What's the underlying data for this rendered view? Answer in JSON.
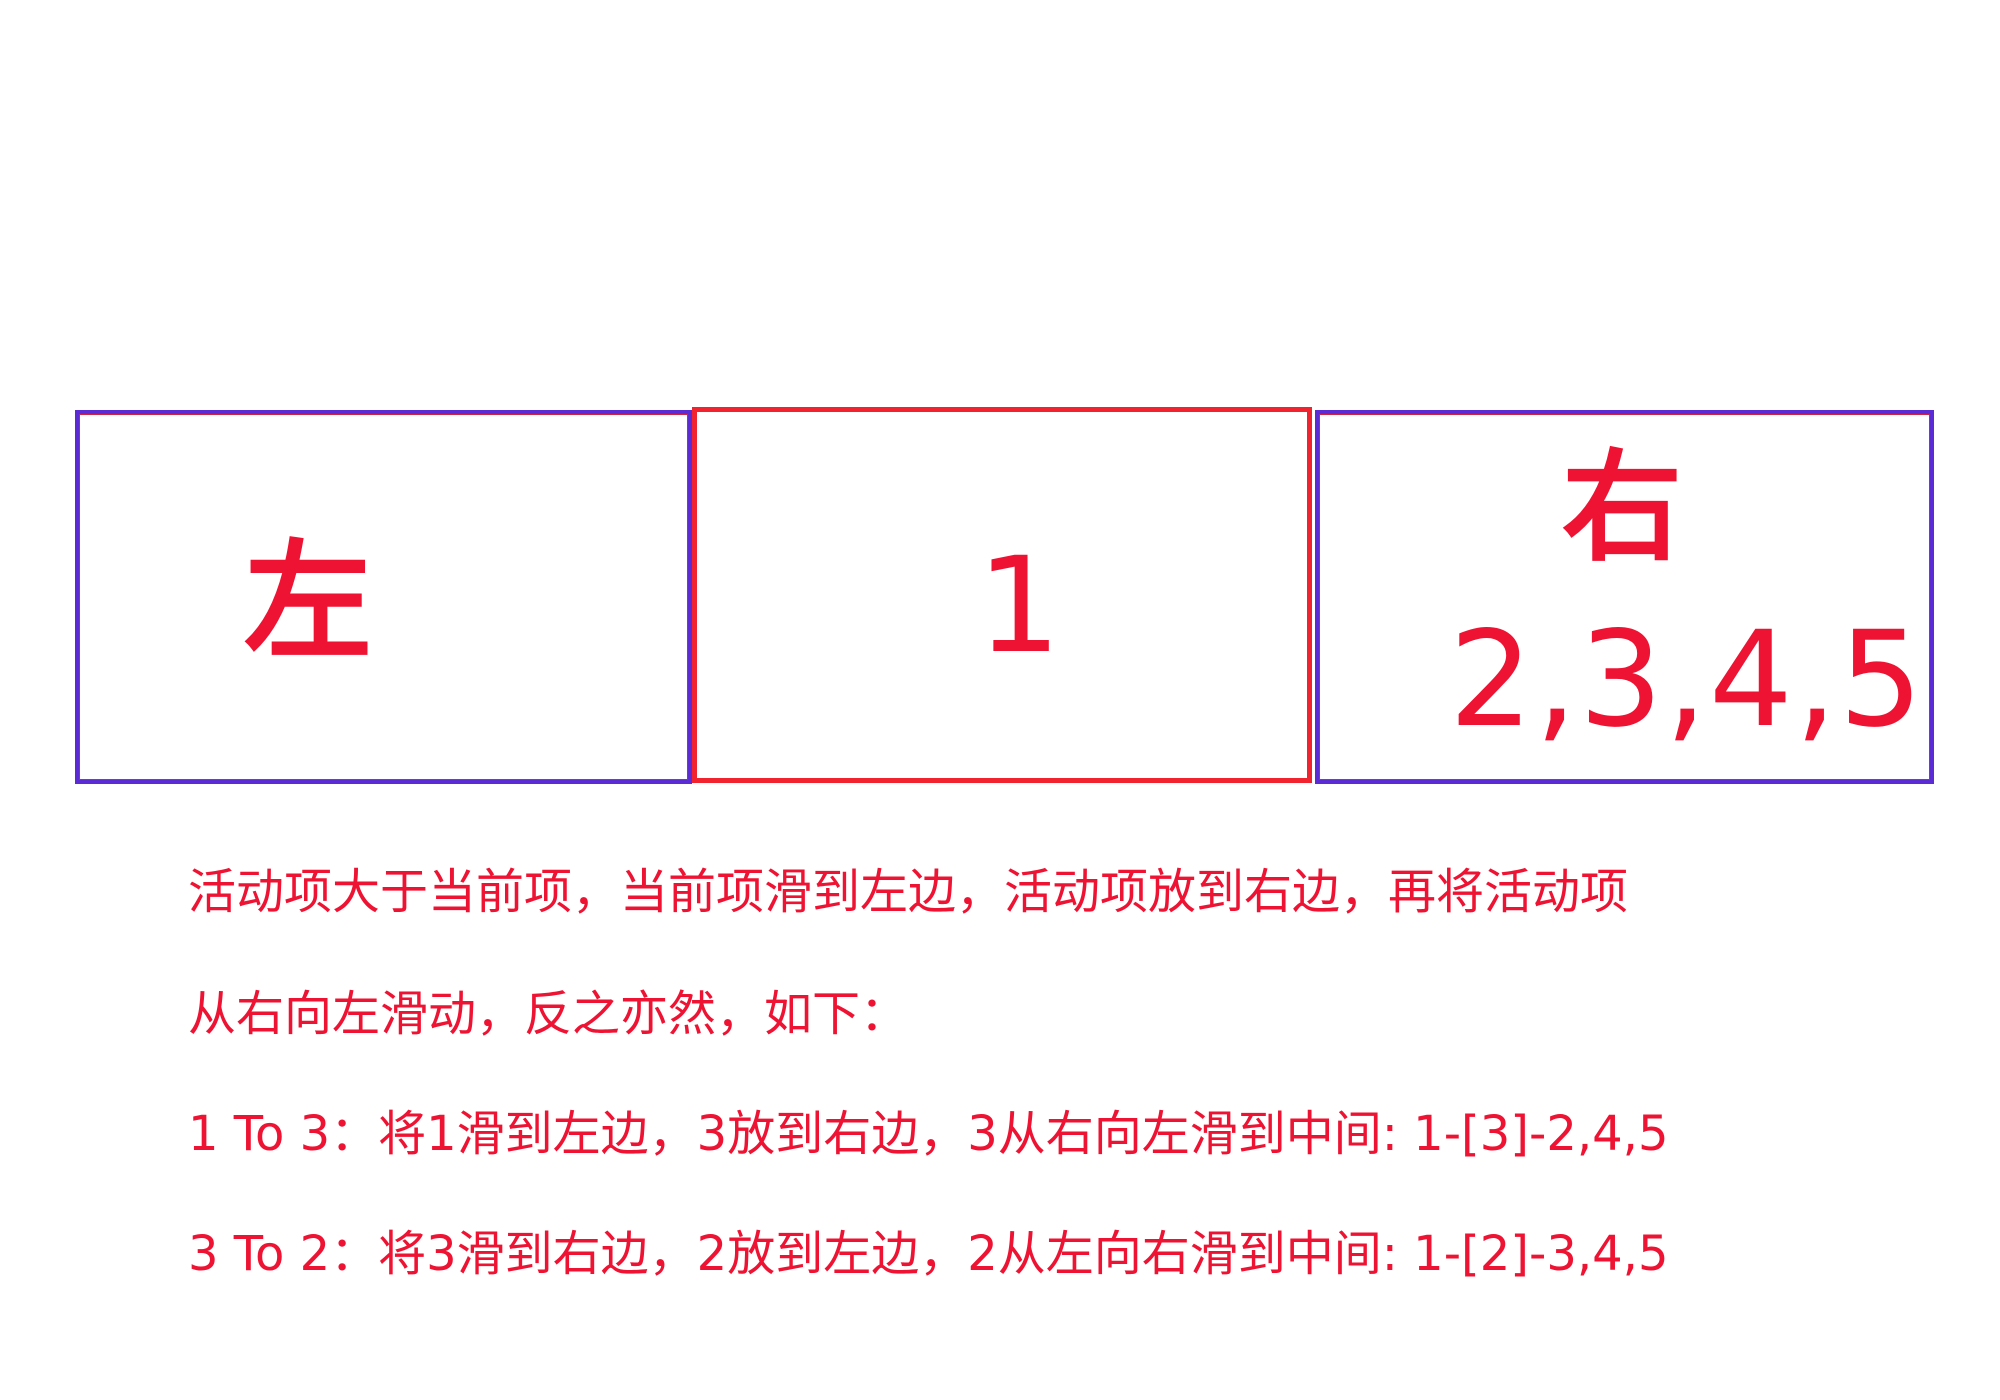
{
  "diagram": {
    "left_label": "左",
    "center_label": "1",
    "right_label": "右",
    "right_items": "2,3,4,5",
    "description": {
      "line1": "活动项大于当前项，当前项滑到左边，活动项放到右边，再将活动项",
      "line2": "从右向左滑动，反之亦然，如下：",
      "line3": "1 To 3：将1滑到左边，3放到右边，3从右向左滑到中间: 1-[3]-2,4,5",
      "line4": "3 To 2：将3滑到右边，2放到左边，2从左向右滑到中间: 1-[2]-3,4,5"
    }
  },
  "colors": {
    "text": "#ee1332",
    "side_border": "#5b2bd6",
    "center_border": "#f0232f",
    "background": "#ffffff"
  }
}
